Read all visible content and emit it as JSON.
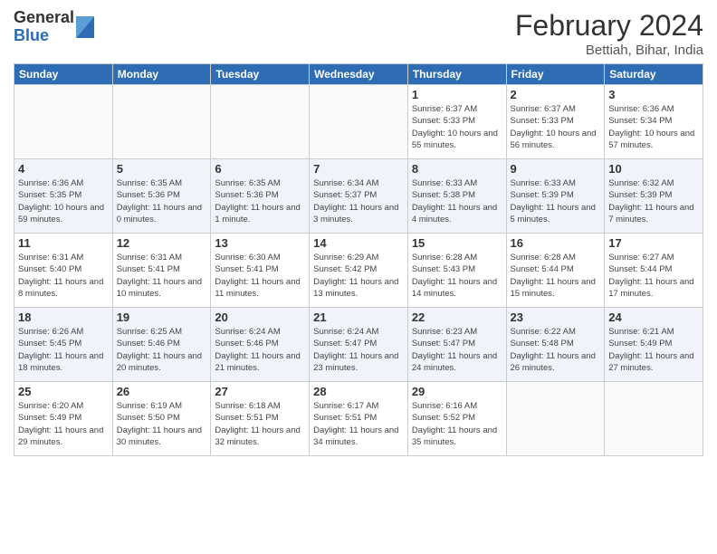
{
  "logo": {
    "general": "General",
    "blue": "Blue"
  },
  "title": "February 2024",
  "location": "Bettiah, Bihar, India",
  "days_of_week": [
    "Sunday",
    "Monday",
    "Tuesday",
    "Wednesday",
    "Thursday",
    "Friday",
    "Saturday"
  ],
  "weeks": [
    [
      {
        "day": "",
        "info": ""
      },
      {
        "day": "",
        "info": ""
      },
      {
        "day": "",
        "info": ""
      },
      {
        "day": "",
        "info": ""
      },
      {
        "day": "1",
        "info": "Sunrise: 6:37 AM\nSunset: 5:33 PM\nDaylight: 10 hours and 55 minutes."
      },
      {
        "day": "2",
        "info": "Sunrise: 6:37 AM\nSunset: 5:33 PM\nDaylight: 10 hours and 56 minutes."
      },
      {
        "day": "3",
        "info": "Sunrise: 6:36 AM\nSunset: 5:34 PM\nDaylight: 10 hours and 57 minutes."
      }
    ],
    [
      {
        "day": "4",
        "info": "Sunrise: 6:36 AM\nSunset: 5:35 PM\nDaylight: 10 hours and 59 minutes."
      },
      {
        "day": "5",
        "info": "Sunrise: 6:35 AM\nSunset: 5:36 PM\nDaylight: 11 hours and 0 minutes."
      },
      {
        "day": "6",
        "info": "Sunrise: 6:35 AM\nSunset: 5:36 PM\nDaylight: 11 hours and 1 minute."
      },
      {
        "day": "7",
        "info": "Sunrise: 6:34 AM\nSunset: 5:37 PM\nDaylight: 11 hours and 3 minutes."
      },
      {
        "day": "8",
        "info": "Sunrise: 6:33 AM\nSunset: 5:38 PM\nDaylight: 11 hours and 4 minutes."
      },
      {
        "day": "9",
        "info": "Sunrise: 6:33 AM\nSunset: 5:39 PM\nDaylight: 11 hours and 5 minutes."
      },
      {
        "day": "10",
        "info": "Sunrise: 6:32 AM\nSunset: 5:39 PM\nDaylight: 11 hours and 7 minutes."
      }
    ],
    [
      {
        "day": "11",
        "info": "Sunrise: 6:31 AM\nSunset: 5:40 PM\nDaylight: 11 hours and 8 minutes."
      },
      {
        "day": "12",
        "info": "Sunrise: 6:31 AM\nSunset: 5:41 PM\nDaylight: 11 hours and 10 minutes."
      },
      {
        "day": "13",
        "info": "Sunrise: 6:30 AM\nSunset: 5:41 PM\nDaylight: 11 hours and 11 minutes."
      },
      {
        "day": "14",
        "info": "Sunrise: 6:29 AM\nSunset: 5:42 PM\nDaylight: 11 hours and 13 minutes."
      },
      {
        "day": "15",
        "info": "Sunrise: 6:28 AM\nSunset: 5:43 PM\nDaylight: 11 hours and 14 minutes."
      },
      {
        "day": "16",
        "info": "Sunrise: 6:28 AM\nSunset: 5:44 PM\nDaylight: 11 hours and 15 minutes."
      },
      {
        "day": "17",
        "info": "Sunrise: 6:27 AM\nSunset: 5:44 PM\nDaylight: 11 hours and 17 minutes."
      }
    ],
    [
      {
        "day": "18",
        "info": "Sunrise: 6:26 AM\nSunset: 5:45 PM\nDaylight: 11 hours and 18 minutes."
      },
      {
        "day": "19",
        "info": "Sunrise: 6:25 AM\nSunset: 5:46 PM\nDaylight: 11 hours and 20 minutes."
      },
      {
        "day": "20",
        "info": "Sunrise: 6:24 AM\nSunset: 5:46 PM\nDaylight: 11 hours and 21 minutes."
      },
      {
        "day": "21",
        "info": "Sunrise: 6:24 AM\nSunset: 5:47 PM\nDaylight: 11 hours and 23 minutes."
      },
      {
        "day": "22",
        "info": "Sunrise: 6:23 AM\nSunset: 5:47 PM\nDaylight: 11 hours and 24 minutes."
      },
      {
        "day": "23",
        "info": "Sunrise: 6:22 AM\nSunset: 5:48 PM\nDaylight: 11 hours and 26 minutes."
      },
      {
        "day": "24",
        "info": "Sunrise: 6:21 AM\nSunset: 5:49 PM\nDaylight: 11 hours and 27 minutes."
      }
    ],
    [
      {
        "day": "25",
        "info": "Sunrise: 6:20 AM\nSunset: 5:49 PM\nDaylight: 11 hours and 29 minutes."
      },
      {
        "day": "26",
        "info": "Sunrise: 6:19 AM\nSunset: 5:50 PM\nDaylight: 11 hours and 30 minutes."
      },
      {
        "day": "27",
        "info": "Sunrise: 6:18 AM\nSunset: 5:51 PM\nDaylight: 11 hours and 32 minutes."
      },
      {
        "day": "28",
        "info": "Sunrise: 6:17 AM\nSunset: 5:51 PM\nDaylight: 11 hours and 34 minutes."
      },
      {
        "day": "29",
        "info": "Sunrise: 6:16 AM\nSunset: 5:52 PM\nDaylight: 11 hours and 35 minutes."
      },
      {
        "day": "",
        "info": ""
      },
      {
        "day": "",
        "info": ""
      }
    ]
  ]
}
